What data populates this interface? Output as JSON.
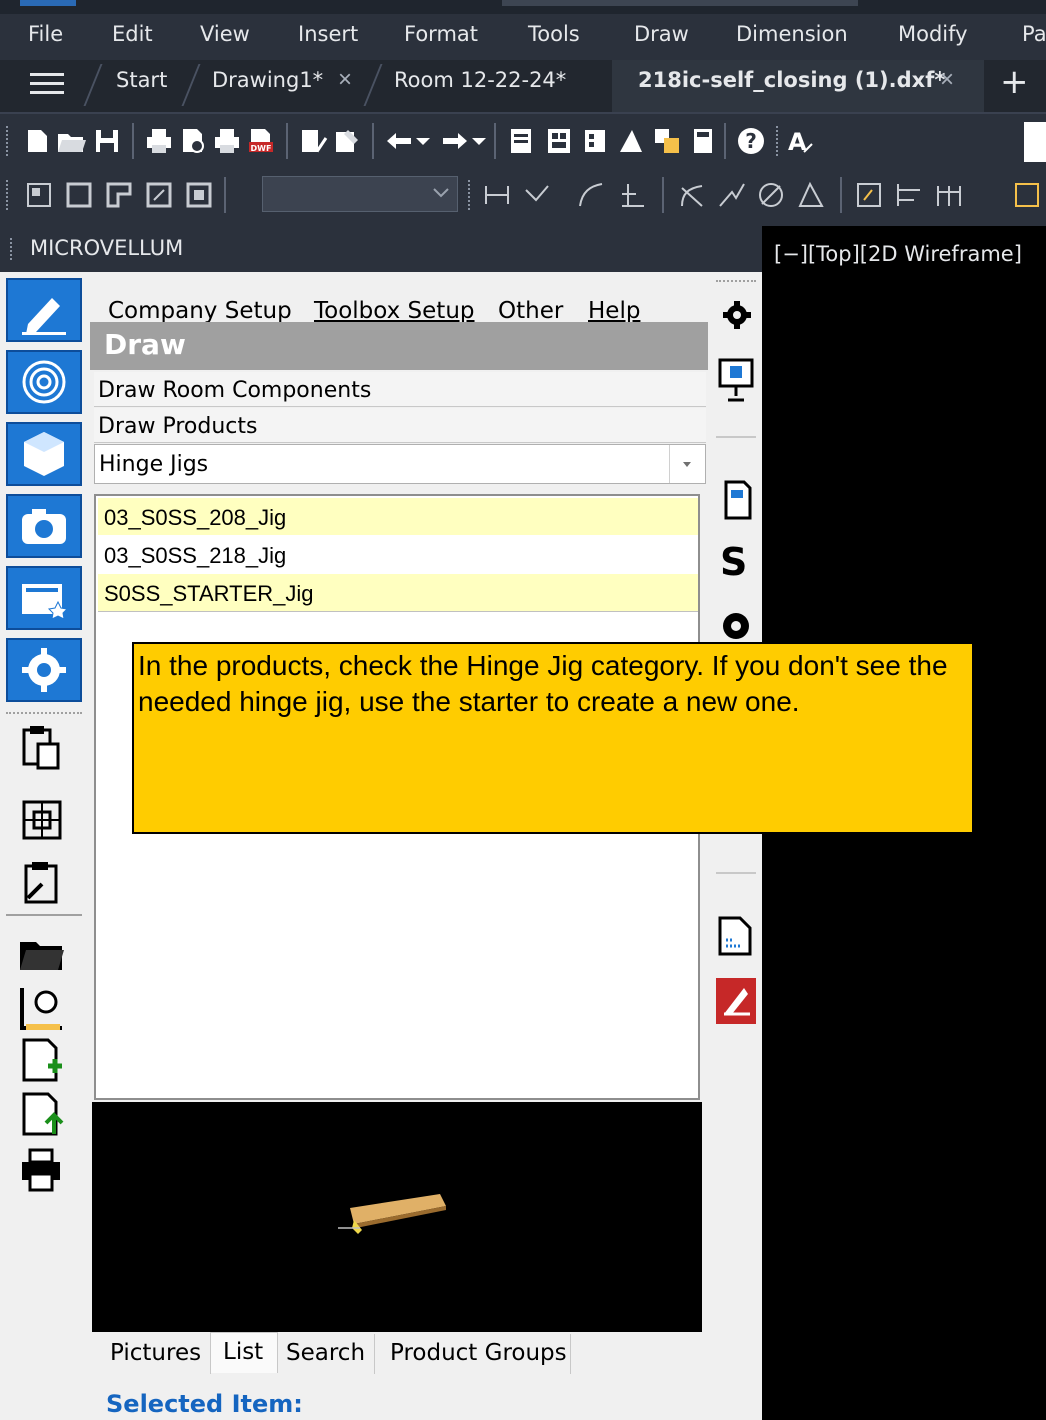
{
  "menu": [
    "File",
    "Edit",
    "View",
    "Insert",
    "Format",
    "Tools",
    "Draw",
    "Dimension",
    "Modify",
    "Pa"
  ],
  "tabs": {
    "start": "Start",
    "drawing1": "Drawing1*",
    "room": "Room 12-22-24*",
    "active": "218ic-self_closing (1).dxf*",
    "close_glyph": "×",
    "add_glyph": "+"
  },
  "panel": {
    "title": "MICROVELLUM",
    "menu": {
      "company_setup": "Company Setup",
      "toolbox_setup": "Toolbox Setup",
      "other": "Other",
      "help": "Help"
    },
    "section_title": "Draw",
    "categories": [
      "Draw Room Components",
      "Draw Products"
    ],
    "combo_value": "Hinge Jigs",
    "list_items": [
      {
        "label": "03_S0SS_208_Jig",
        "highlighted": true
      },
      {
        "label": "03_S0SS_218_Jig",
        "highlighted": false
      },
      {
        "label": "S0SS_STARTER_Jig",
        "highlighted": true
      }
    ],
    "bottom_tabs": [
      "Pictures",
      "List",
      "Search",
      "Product Groups"
    ],
    "selected_item_label": "Selected Item:"
  },
  "viewport": {
    "label": "[−][Top][2D Wireframe]"
  },
  "note": {
    "text": "In the products, check the Hinge Jig category.  If you don't see the needed hinge jig, use the starter to create a new one."
  },
  "right_strip": {
    "s_letter": "S"
  },
  "toolbar2": {
    "dwf_label": "DWF"
  },
  "colors": {
    "accent_blue": "#1e78d4",
    "note_yellow": "#ffcc00",
    "highlight_row": "#ffffc0",
    "dark_bg": "#2b313c"
  }
}
